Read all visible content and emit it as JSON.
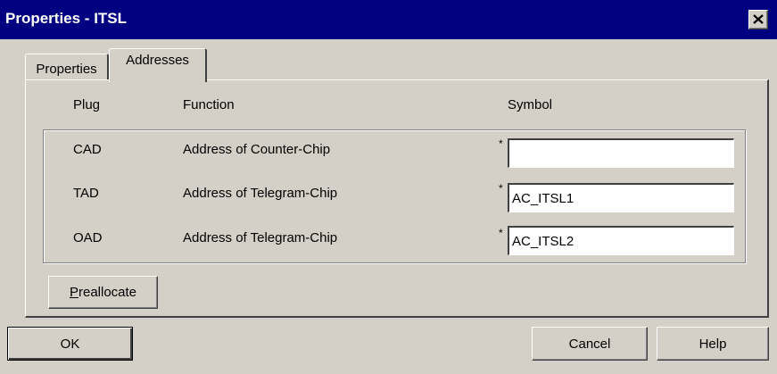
{
  "window": {
    "title": "Properties - ITSL"
  },
  "tabs": [
    {
      "label": "Properties",
      "selected": false
    },
    {
      "label": "Addresses",
      "selected": true
    }
  ],
  "table": {
    "headers": {
      "plug": "Plug",
      "function": "Function",
      "symbol": "Symbol"
    },
    "rows": [
      {
        "plug": "CAD",
        "function": "Address of Counter-Chip",
        "marker": "*",
        "symbol": ""
      },
      {
        "plug": "TAD",
        "function": "Address of Telegram-Chip",
        "marker": "*",
        "symbol": "AC_ITSL1"
      },
      {
        "plug": "OAD",
        "function": "Address of Telegram-Chip",
        "marker": "*",
        "symbol": "AC_ITSL2"
      }
    ]
  },
  "buttons": {
    "preallocate": {
      "mnemonic": "P",
      "rest": "reallocate"
    },
    "ok": "OK",
    "cancel": "Cancel",
    "help": "Help"
  },
  "icons": {
    "close": "close-icon"
  }
}
